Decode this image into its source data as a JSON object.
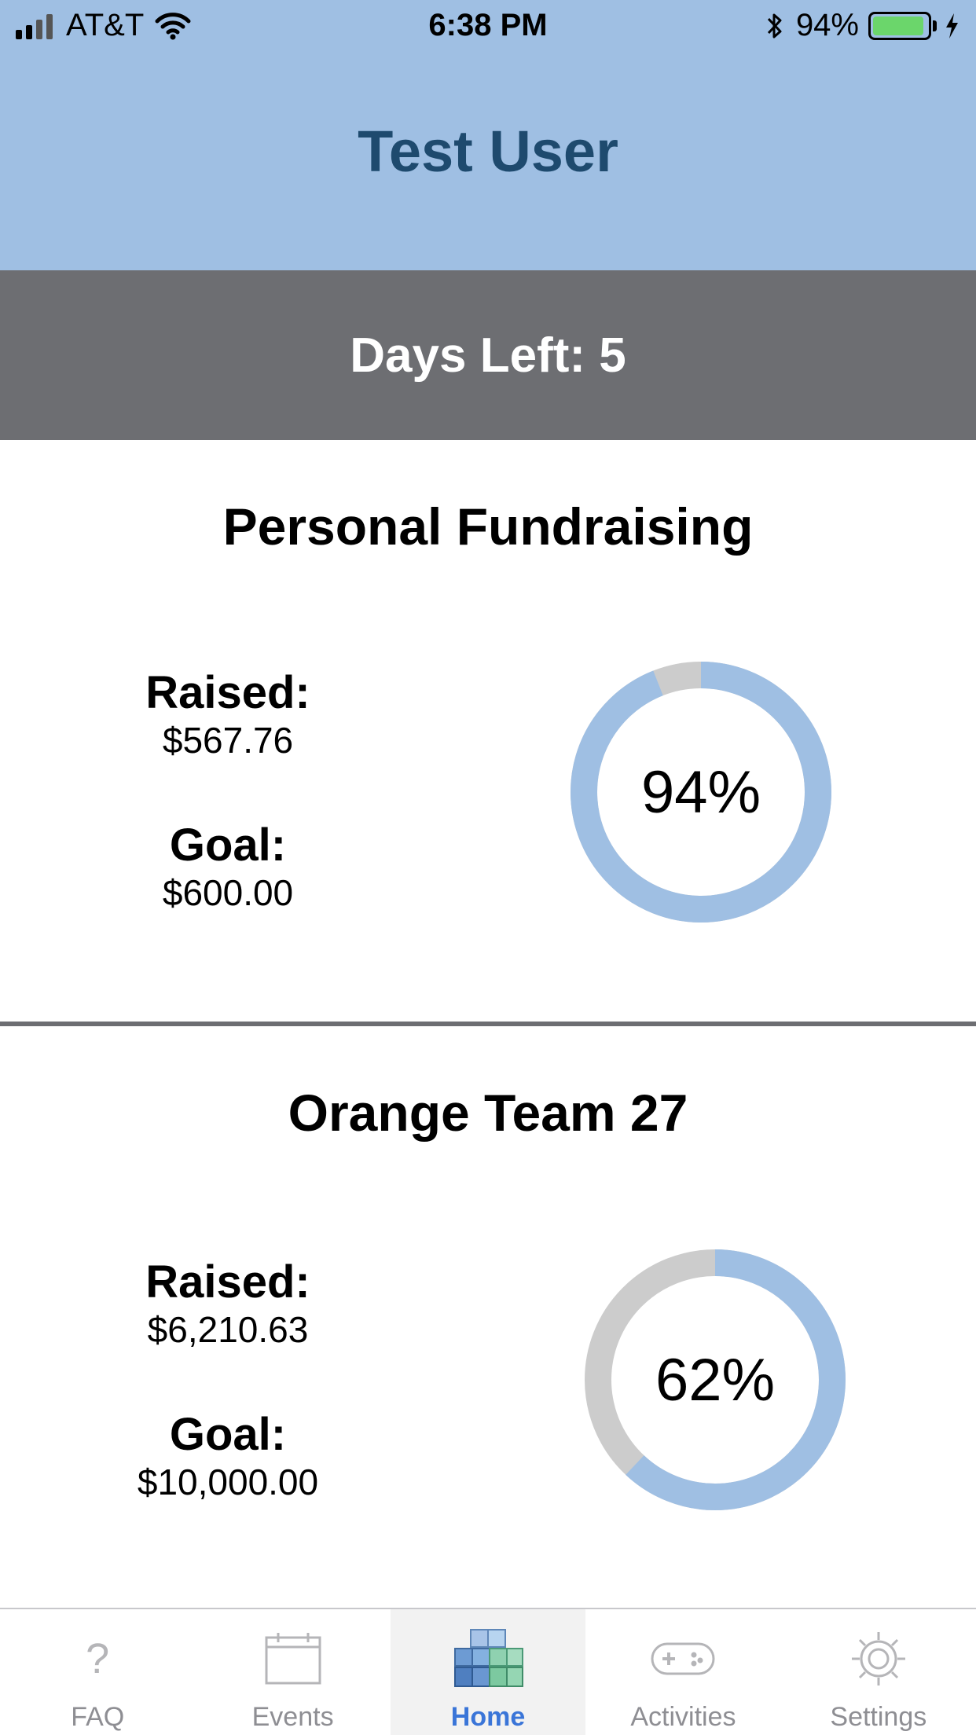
{
  "status_bar": {
    "carrier": "AT&T",
    "time": "6:38 PM",
    "battery_percent": "94%",
    "battery_level": 0.94
  },
  "header": {
    "title": "Test User"
  },
  "days_left": {
    "text": "Days Left: 5"
  },
  "personal": {
    "title": "Personal Fundraising",
    "raised_label": "Raised:",
    "raised_value": "$567.76",
    "goal_label": "Goal:",
    "goal_value": "$600.00",
    "percent_text": "94%",
    "percent": 94
  },
  "team": {
    "title": "Orange Team 27",
    "raised_label": "Raised:",
    "raised_value": "$6,210.63",
    "goal_label": "Goal:",
    "goal_value": "$10,000.00",
    "percent_text": "62%",
    "percent": 62
  },
  "colors": {
    "header_bg": "#9fbfe3",
    "title_color": "#1e4a6e",
    "band_bg": "#6d6e72",
    "ring_progress": "#9fbfe3",
    "ring_track": "#cccccc",
    "tab_active": "#3a75d8",
    "tab_inactive": "#8e8e93"
  },
  "tabs": [
    {
      "label": "FAQ",
      "icon": "question-icon"
    },
    {
      "label": "Events",
      "icon": "calendar-icon"
    },
    {
      "label": "Home",
      "icon": "blocks-icon",
      "active": true
    },
    {
      "label": "Activities",
      "icon": "gamepad-icon"
    },
    {
      "label": "Settings",
      "icon": "gear-icon"
    }
  ]
}
